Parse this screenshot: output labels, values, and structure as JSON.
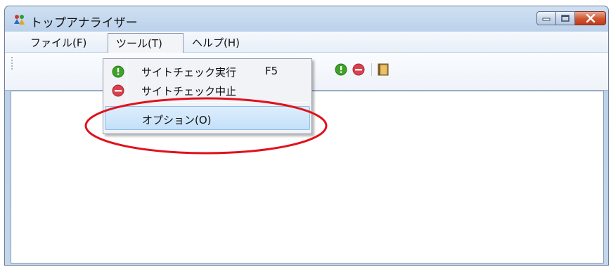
{
  "window": {
    "title": "トップアナライザー",
    "app_icon": "people-icon",
    "controls": {
      "minimize": "minimize-icon",
      "maximize": "maximize-icon",
      "close": "close-icon"
    }
  },
  "menubar": {
    "items": [
      {
        "label": "ファイル(F)"
      },
      {
        "label": "ツール(T)",
        "state": "open"
      },
      {
        "label": "ヘルプ(H)"
      }
    ]
  },
  "toolbar": {
    "icons": [
      "start-check-icon",
      "stop-check-icon",
      "exit-door-icon"
    ]
  },
  "tool_menu": {
    "items": [
      {
        "label": "サイトチェック実行",
        "shortcut": "F5",
        "icon": "start-check-icon"
      },
      {
        "label": "サイトチェック中止",
        "icon": "stop-check-icon"
      },
      {
        "label": "オプション(O)",
        "state": "hovered"
      }
    ]
  },
  "annotation": {
    "shape": "ellipse",
    "color": "#e0121b"
  },
  "colors": {
    "green_icon": "#3fa22a",
    "red_icon": "#d9414f",
    "hover_bg": "#c4e0fa"
  }
}
